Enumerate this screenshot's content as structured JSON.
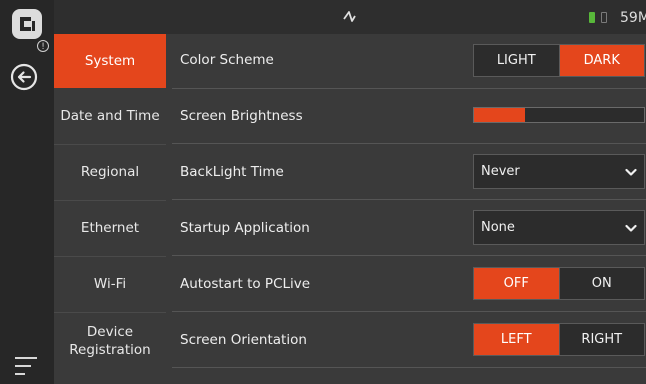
{
  "status": {
    "time": "59M"
  },
  "sidebar": {
    "items": [
      {
        "label": "System"
      },
      {
        "label": "Date and Time"
      },
      {
        "label": "Regional"
      },
      {
        "label": "Ethernet"
      },
      {
        "label": "Wi-Fi"
      },
      {
        "label": "Device Registration"
      }
    ]
  },
  "settings": {
    "color_scheme": {
      "label": "Color Scheme",
      "options": [
        "LIGHT",
        "DARK"
      ],
      "selected": "DARK"
    },
    "screen_brightness": {
      "label": "Screen Brightness",
      "level": 0.3
    },
    "backlight_time": {
      "label": "BackLight Time",
      "value": "Never"
    },
    "startup_application": {
      "label": "Startup Application",
      "value": "None"
    },
    "autostart": {
      "label": "Autostart to PCLive",
      "options": [
        "OFF",
        "ON"
      ],
      "selected": "OFF"
    },
    "orientation": {
      "label": "Screen Orientation",
      "options": [
        "LEFT",
        "RIGHT"
      ],
      "selected": "LEFT"
    }
  },
  "colors": {
    "accent": "#e4461c",
    "background": "#3a3a3a",
    "rail": "#272727"
  },
  "icons": [
    "app-logo-icon",
    "info-icon",
    "back-arrow-icon",
    "menu-icon",
    "signal-icon",
    "battery-icon",
    "chevron-down-icon"
  ]
}
